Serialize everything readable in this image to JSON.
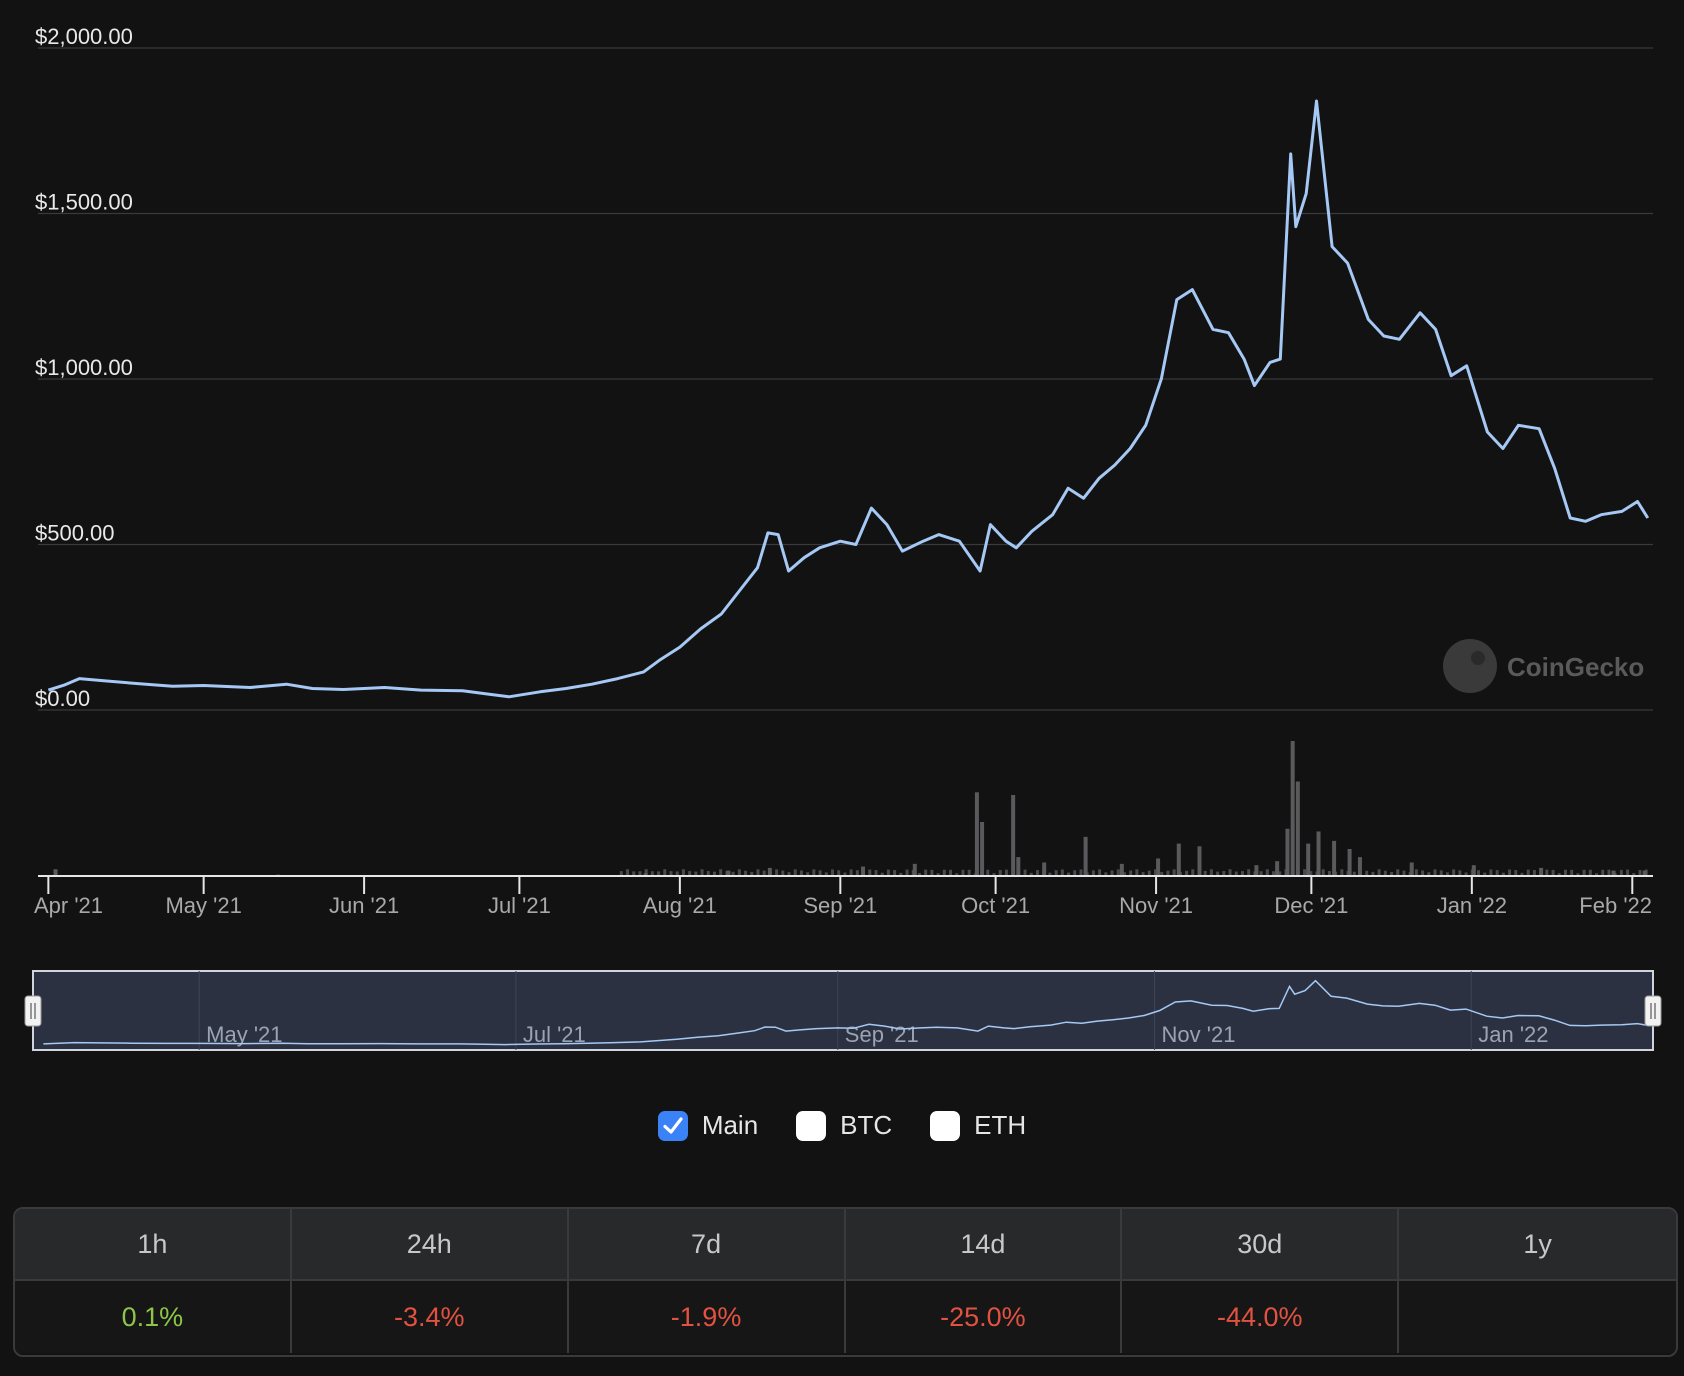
{
  "chart_data": {
    "type": "line",
    "y_axis": {
      "ticks": [
        "$2,000.00",
        "$1,500.00",
        "$1,000.00",
        "$500.00",
        "$0.00"
      ],
      "ylim": [
        0,
        2000
      ]
    },
    "x_axis": {
      "ticks": [
        "Apr '21",
        "May '21",
        "Jun '21",
        "Jul '21",
        "Aug '21",
        "Sep '21",
        "Oct '21",
        "Nov '21",
        "Dec '21",
        "Jan '22",
        "Feb '22"
      ]
    },
    "color": "#a6c8f5",
    "series": [
      {
        "name": "Main",
        "points": [
          [
            "2021-04-01",
            60
          ],
          [
            "2021-04-04",
            75
          ],
          [
            "2021-04-07",
            95
          ],
          [
            "2021-04-12",
            88
          ],
          [
            "2021-04-18",
            80
          ],
          [
            "2021-04-25",
            72
          ],
          [
            "2021-05-01",
            74
          ],
          [
            "2021-05-10",
            68
          ],
          [
            "2021-05-17",
            78
          ],
          [
            "2021-05-22",
            65
          ],
          [
            "2021-05-28",
            62
          ],
          [
            "2021-06-05",
            68
          ],
          [
            "2021-06-12",
            60
          ],
          [
            "2021-06-20",
            58
          ],
          [
            "2021-06-25",
            48
          ],
          [
            "2021-06-29",
            40
          ],
          [
            "2021-07-05",
            55
          ],
          [
            "2021-07-10",
            65
          ],
          [
            "2021-07-15",
            78
          ],
          [
            "2021-07-20",
            95
          ],
          [
            "2021-07-25",
            115
          ],
          [
            "2021-07-28",
            150
          ],
          [
            "2021-08-01",
            190
          ],
          [
            "2021-08-05",
            245
          ],
          [
            "2021-08-09",
            290
          ],
          [
            "2021-08-13",
            370
          ],
          [
            "2021-08-16",
            430
          ],
          [
            "2021-08-18",
            535
          ],
          [
            "2021-08-20",
            530
          ],
          [
            "2021-08-22",
            420
          ],
          [
            "2021-08-25",
            460
          ],
          [
            "2021-08-28",
            490
          ],
          [
            "2021-09-01",
            510
          ],
          [
            "2021-09-04",
            500
          ],
          [
            "2021-09-07",
            610
          ],
          [
            "2021-09-10",
            560
          ],
          [
            "2021-09-13",
            480
          ],
          [
            "2021-09-17",
            510
          ],
          [
            "2021-09-20",
            530
          ],
          [
            "2021-09-24",
            510
          ],
          [
            "2021-09-28",
            420
          ],
          [
            "2021-09-30",
            560
          ],
          [
            "2021-10-03",
            510
          ],
          [
            "2021-10-05",
            490
          ],
          [
            "2021-10-08",
            540
          ],
          [
            "2021-10-12",
            590
          ],
          [
            "2021-10-15",
            670
          ],
          [
            "2021-10-18",
            640
          ],
          [
            "2021-10-21",
            700
          ],
          [
            "2021-10-24",
            740
          ],
          [
            "2021-10-27",
            790
          ],
          [
            "2021-10-30",
            860
          ],
          [
            "2021-11-02",
            1000
          ],
          [
            "2021-11-05",
            1240
          ],
          [
            "2021-11-08",
            1270
          ],
          [
            "2021-11-12",
            1150
          ],
          [
            "2021-11-15",
            1140
          ],
          [
            "2021-11-18",
            1060
          ],
          [
            "2021-11-20",
            980
          ],
          [
            "2021-11-23",
            1050
          ],
          [
            "2021-11-25",
            1060
          ],
          [
            "2021-11-27",
            1680
          ],
          [
            "2021-11-28",
            1460
          ],
          [
            "2021-11-30",
            1560
          ],
          [
            "2021-12-02",
            1840
          ],
          [
            "2021-12-05",
            1400
          ],
          [
            "2021-12-08",
            1350
          ],
          [
            "2021-12-12",
            1180
          ],
          [
            "2021-12-15",
            1130
          ],
          [
            "2021-12-18",
            1120
          ],
          [
            "2021-12-22",
            1200
          ],
          [
            "2021-12-25",
            1150
          ],
          [
            "2021-12-28",
            1010
          ],
          [
            "2021-12-31",
            1040
          ],
          [
            "2022-01-04",
            840
          ],
          [
            "2022-01-07",
            790
          ],
          [
            "2022-01-10",
            860
          ],
          [
            "2022-01-14",
            850
          ],
          [
            "2022-01-17",
            730
          ],
          [
            "2022-01-20",
            580
          ],
          [
            "2022-01-23",
            570
          ],
          [
            "2022-01-26",
            590
          ],
          [
            "2022-01-30",
            600
          ],
          [
            "2022-02-02",
            630
          ],
          [
            "2022-02-04",
            580
          ]
        ]
      }
    ],
    "volume_bars": [
      [
        "2021-04-02",
        0.05
      ],
      [
        "2021-05-15",
        0.01
      ],
      [
        "2021-07-25",
        0.02
      ],
      [
        "2021-08-10",
        0.04
      ],
      [
        "2021-08-18",
        0.06
      ],
      [
        "2021-09-05",
        0.07
      ],
      [
        "2021-09-15",
        0.09
      ],
      [
        "2021-09-27",
        0.62
      ],
      [
        "2021-09-28",
        0.4
      ],
      [
        "2021-10-04",
        0.6
      ],
      [
        "2021-10-05",
        0.14
      ],
      [
        "2021-10-10",
        0.1
      ],
      [
        "2021-10-18",
        0.29
      ],
      [
        "2021-10-25",
        0.09
      ],
      [
        "2021-11-01",
        0.13
      ],
      [
        "2021-11-05",
        0.24
      ],
      [
        "2021-11-09",
        0.22
      ],
      [
        "2021-11-20",
        0.08
      ],
      [
        "2021-11-24",
        0.11
      ],
      [
        "2021-11-26",
        0.35
      ],
      [
        "2021-11-27",
        1.0
      ],
      [
        "2021-11-28",
        0.7
      ],
      [
        "2021-11-30",
        0.24
      ],
      [
        "2021-12-02",
        0.33
      ],
      [
        "2021-12-05",
        0.26
      ],
      [
        "2021-12-08",
        0.2
      ],
      [
        "2021-12-10",
        0.14
      ],
      [
        "2021-12-20",
        0.1
      ],
      [
        "2022-01-01",
        0.08
      ],
      [
        "2022-01-14",
        0.06
      ],
      [
        "2022-01-28",
        0.04
      ],
      [
        "2022-02-03",
        0.04
      ]
    ],
    "navigator": {
      "labels": [
        "May '21",
        "Jul '21",
        "Sep '21",
        "Nov '21",
        "Jan '22"
      ]
    },
    "watermark": "CoinGecko"
  },
  "legend": [
    {
      "label": "Main",
      "checked": true
    },
    {
      "label": "BTC",
      "checked": false
    },
    {
      "label": "ETH",
      "checked": false
    }
  ],
  "performance": {
    "headers": [
      "1h",
      "24h",
      "7d",
      "14d",
      "30d",
      "1y"
    ],
    "values": [
      "0.1%",
      "-3.4%",
      "-1.9%",
      "-25.0%",
      "-44.0%",
      ""
    ],
    "colors": {
      "positive": "#8dc647",
      "negative": "#e15241"
    }
  }
}
